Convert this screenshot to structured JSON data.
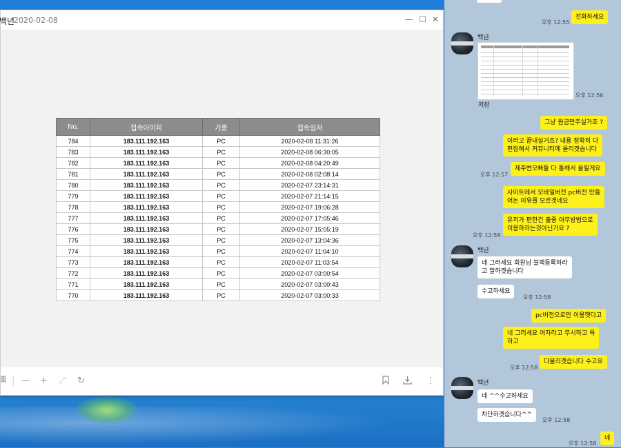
{
  "viewer": {
    "title_name": "백년",
    "title_date": "2020-02-08",
    "minimize": "—",
    "maximize": "☐",
    "close": "✕"
  },
  "table": {
    "headers": [
      "No.",
      "접속아이피",
      "기종",
      "접속일자"
    ],
    "rows": [
      [
        "784",
        "183.111.192.163",
        "PC",
        "2020-02-08 11:31:26"
      ],
      [
        "783",
        "183.111.192.163",
        "PC",
        "2020-02-08 06:30:05"
      ],
      [
        "782",
        "183.111.192.163",
        "PC",
        "2020-02-08 04:20:49"
      ],
      [
        "781",
        "183.111.192.163",
        "PC",
        "2020-02-08 02:08:14"
      ],
      [
        "780",
        "183.111.192.163",
        "PC",
        "2020-02-07 23:14:31"
      ],
      [
        "779",
        "183.111.192.163",
        "PC",
        "2020-02-07 21:14:15"
      ],
      [
        "778",
        "183.111.192.163",
        "PC",
        "2020-02-07 19:06:28"
      ],
      [
        "777",
        "183.111.192.163",
        "PC",
        "2020-02-07 17:05:46"
      ],
      [
        "776",
        "183.111.192.163",
        "PC",
        "2020-02-07 15:05:19"
      ],
      [
        "775",
        "183.111.192.163",
        "PC",
        "2020-02-07 13:04:36"
      ],
      [
        "774",
        "183.111.192.163",
        "PC",
        "2020-02-07 11:04:10"
      ],
      [
        "773",
        "183.111.192.163",
        "PC",
        "2020-02-07 11:03:54"
      ],
      [
        "772",
        "183.111.192.163",
        "PC",
        "2020-02-07 03:00:54"
      ],
      [
        "771",
        "183.111.192.163",
        "PC",
        "2020-02-07 03:00:43"
      ],
      [
        "770",
        "183.111.192.163",
        "PC",
        "2020-02-07 03:00:33"
      ]
    ]
  },
  "toolbar": {
    "grid_icon": "grid-icon",
    "zoom_out": "—",
    "zoom_in": "+",
    "fit": "⤢",
    "rotate": "↻",
    "bookmark": "bookmark-icon",
    "download": "download-icon",
    "more": "⋮"
  },
  "chat": {
    "sender": "백년",
    "save_label": "저장",
    "messages": {
      "m1": "전화하세요",
      "t1": "오후 12:55",
      "t_img": "오후 12:56",
      "m2": "그냥 원금만주실거죠 ?",
      "m3": "이러고 끝내실거죠? 내용 정확히 다\n편집해서 커뮤니티에 올리겟습니다",
      "m4": "제주변오빠들 다 통해서 올릴게요",
      "t4": "오후 12:57",
      "m5": "사이트에서 모바일버전 pc버전 만들\n어논 이유를 모르겟네요",
      "m6": "유저가 편한건 출중 아무방법으로\n이용하라는것아닌가요 ?",
      "t6": "오후 12:58",
      "o1": "네 그러세요 회원님 블랙등록하라\n고 말하겟습니다",
      "o2": "수고하세요",
      "to2": "오후 12:58",
      "m7": "pc버전으로만 이용햇다고",
      "m8": "네 그러세요 여자라고 무시하고 욕\n하고",
      "m9": "다올리겟습니다 수고요",
      "t9": "오후 12:58",
      "o3": "네 ^^수고하세요",
      "o4": "차단하겟습니다^^",
      "to4": "오후 12:58",
      "m10": "네",
      "t10": "오후 12:58"
    }
  },
  "colors": {
    "my_bubble": "#fef01b",
    "chat_bg": "#b2c7d9",
    "table_header": "#8c8c8c"
  }
}
